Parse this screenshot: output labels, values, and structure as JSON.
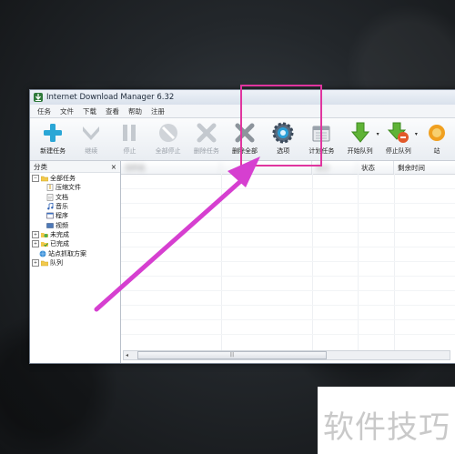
{
  "window": {
    "title": "Internet Download Manager 6.32"
  },
  "menu": [
    "任务",
    "文件",
    "下载",
    "查看",
    "帮助",
    "注册"
  ],
  "toolbar": [
    {
      "label": "新建任务",
      "icon": "plus-icon",
      "enabled": true
    },
    {
      "label": "继续",
      "icon": "resume-icon",
      "enabled": false
    },
    {
      "label": "停止",
      "icon": "pause-icon",
      "enabled": false
    },
    {
      "label": "全部停止",
      "icon": "stop-all-icon",
      "enabled": false
    },
    {
      "label": "删除任务",
      "icon": "delete-icon",
      "enabled": false
    },
    {
      "label": "删除全部",
      "icon": "delete-all-icon",
      "enabled": true
    },
    {
      "label": "选项",
      "icon": "gear-icon",
      "enabled": true
    },
    {
      "label": "计划任务",
      "icon": "scheduler-icon",
      "enabled": true
    },
    {
      "label": "开始队列",
      "icon": "start-queue-icon",
      "enabled": true
    },
    {
      "label": "停止队列",
      "icon": "stop-queue-icon",
      "enabled": true
    },
    {
      "label": "站",
      "icon": "grabber-icon",
      "enabled": true
    }
  ],
  "sidebar": {
    "title": "分类",
    "close_glyph": "×",
    "tree": [
      {
        "label": "全部任务",
        "level": 0,
        "expander": "−",
        "icon": "folder-open-icon"
      },
      {
        "label": "压缩文件",
        "level": 1,
        "icon": "zip-file-icon"
      },
      {
        "label": "文档",
        "level": 1,
        "icon": "document-icon"
      },
      {
        "label": "音乐",
        "level": 1,
        "icon": "music-icon"
      },
      {
        "label": "程序",
        "level": 1,
        "icon": "program-icon"
      },
      {
        "label": "视频",
        "level": 1,
        "icon": "video-icon"
      },
      {
        "label": "未完成",
        "level": 0,
        "expander": "+",
        "icon": "unfinished-folder-icon"
      },
      {
        "label": "已完成",
        "level": 0,
        "expander": "+",
        "icon": "finished-folder-icon"
      },
      {
        "label": "站点抓取方案",
        "level": 0,
        "icon": "site-grabber-icon"
      },
      {
        "label": "队列",
        "level": 0,
        "expander": "+",
        "icon": "queue-folder-icon"
      }
    ]
  },
  "list": {
    "columns": [
      "文件名",
      "",
      "大小",
      "状态",
      "剩余时间"
    ],
    "scroll_arrow_left": "◂",
    "scroll_thumb_grip": "|||"
  },
  "watermark": {
    "text": "软件技巧"
  },
  "colors": {
    "annotation": "#e0359f",
    "background": "#23272b"
  }
}
